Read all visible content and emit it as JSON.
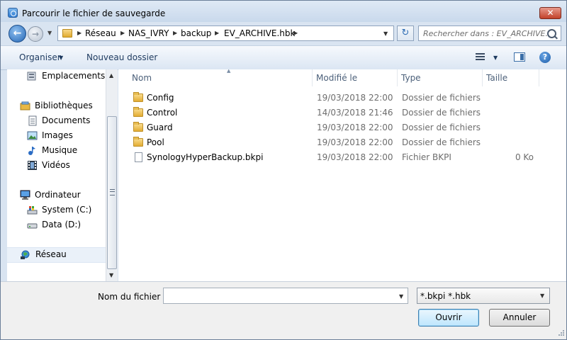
{
  "window": {
    "title": "Parcourir le fichier de sauvegarde",
    "close_label": "✕"
  },
  "address": {
    "crumbs": [
      "Réseau",
      "NAS_IVRY",
      "backup",
      "EV_ARCHIVE.hbk"
    ],
    "search_placeholder": "Rechercher dans : EV_ARCHIVE.hbk"
  },
  "toolbar": {
    "organize": "Organiser",
    "new_folder": "Nouveau dossier",
    "help_label": "?"
  },
  "nav": {
    "items": [
      {
        "label": "Emplacements récents",
        "icon": "recent-places-icon"
      },
      {
        "label": "Bibliothèques",
        "icon": "libraries-icon"
      },
      {
        "label": "Documents",
        "icon": "documents-icon"
      },
      {
        "label": "Images",
        "icon": "pictures-icon"
      },
      {
        "label": "Musique",
        "icon": "music-icon"
      },
      {
        "label": "Vidéos",
        "icon": "videos-icon"
      },
      {
        "label": "Ordinateur",
        "icon": "computer-icon"
      },
      {
        "label": "System (C:)",
        "icon": "system-drive-icon"
      },
      {
        "label": "Data (D:)",
        "icon": "data-drive-icon"
      },
      {
        "label": "Réseau",
        "icon": "network-icon",
        "selected": true
      }
    ]
  },
  "columns": {
    "name": "Nom",
    "modified": "Modifié le",
    "type": "Type",
    "size": "Taille"
  },
  "files": [
    {
      "name": "Config",
      "modified": "19/03/2018 22:00",
      "type": "Dossier de fichiers",
      "size": "",
      "icon": "folder-icon"
    },
    {
      "name": "Control",
      "modified": "14/03/2018 21:46",
      "type": "Dossier de fichiers",
      "size": "",
      "icon": "folder-icon"
    },
    {
      "name": "Guard",
      "modified": "19/03/2018 22:00",
      "type": "Dossier de fichiers",
      "size": "",
      "icon": "folder-icon"
    },
    {
      "name": "Pool",
      "modified": "19/03/2018 22:00",
      "type": "Dossier de fichiers",
      "size": "",
      "icon": "folder-icon"
    },
    {
      "name": "SynologyHyperBackup.bkpi",
      "modified": "19/03/2018 22:00",
      "type": "Fichier BKPI",
      "size": "0 Ko",
      "icon": "file-icon"
    }
  ],
  "footer": {
    "filename_label": "Nom du fichier :",
    "filename_value": "",
    "filter_value": "*.bkpi *.hbk",
    "open_label": "Ouvrir",
    "cancel_label": "Annuler"
  }
}
